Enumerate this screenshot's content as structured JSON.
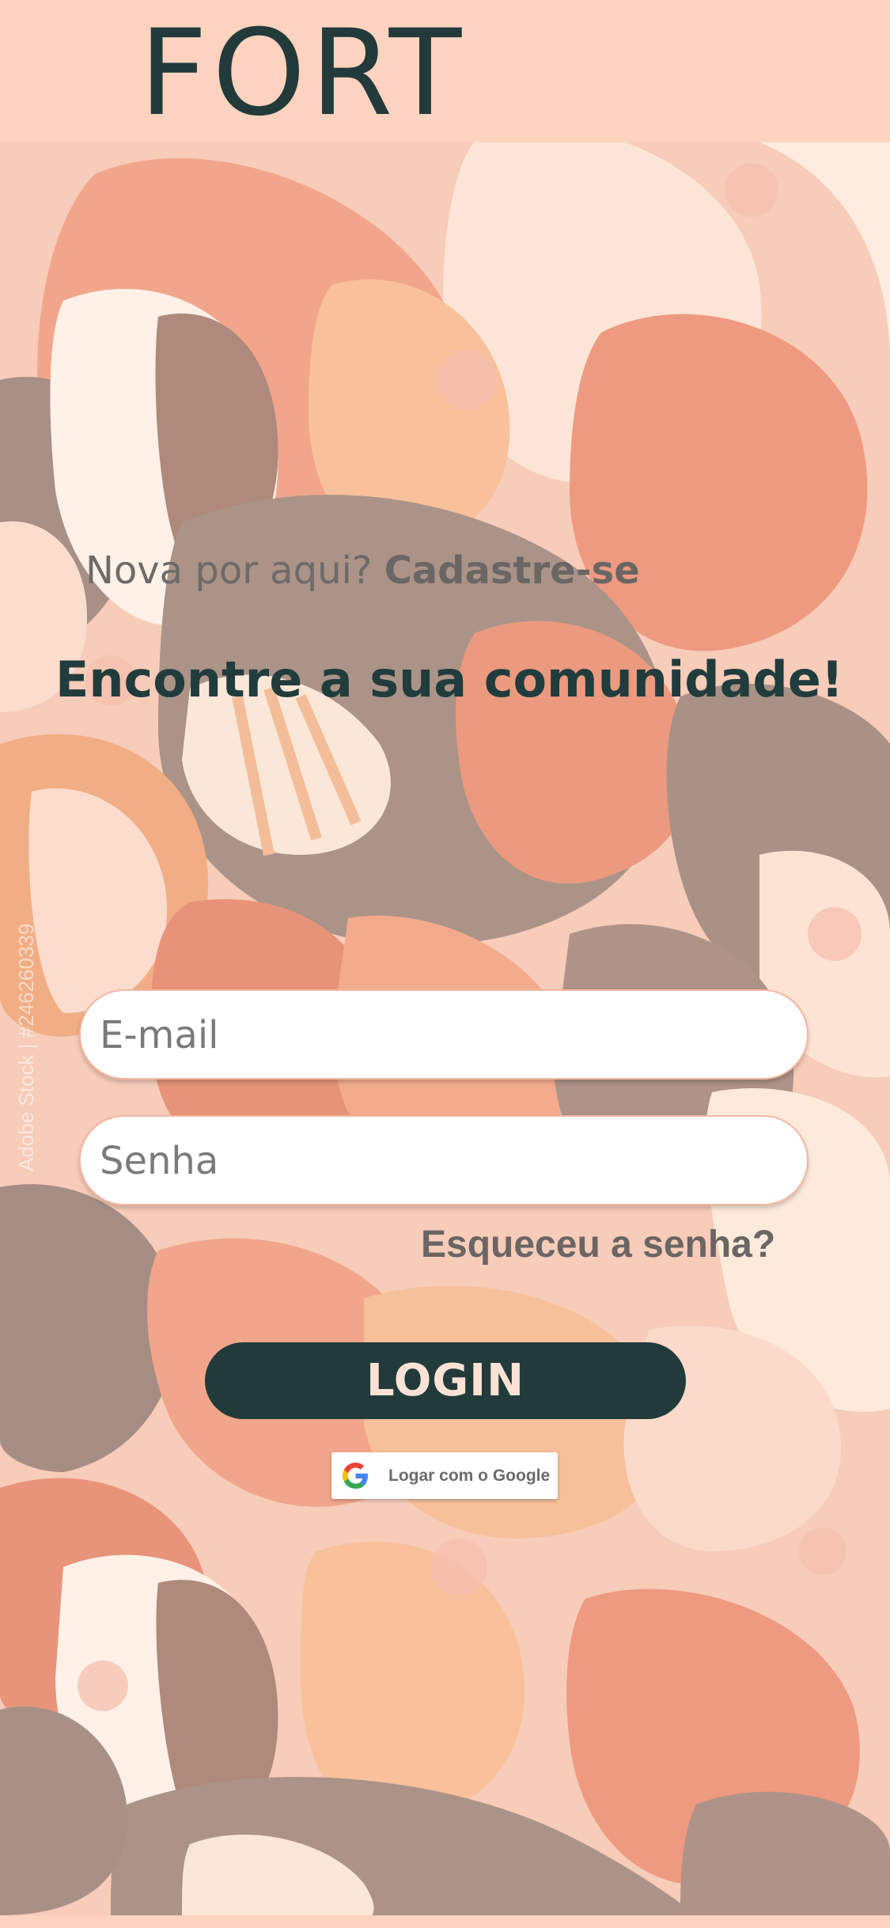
{
  "header": {
    "logo_text": "FORT"
  },
  "background": {
    "watermark": "Adobe Stock | #246260339"
  },
  "signup": {
    "prompt": "Nova por aqui?",
    "link": "Cadastre-se"
  },
  "headline": "Encontre a sua comunidade!",
  "form": {
    "email_placeholder": "E-mail",
    "password_placeholder": "Senha",
    "forgot_link": "Esqueceu a senha?",
    "login_label": "LOGIN",
    "google_label": "Logar com o Google"
  },
  "colors": {
    "header_bg": "#ffd3c0",
    "primary_dark": "#223a3a",
    "button_text": "#fbe2d5"
  }
}
